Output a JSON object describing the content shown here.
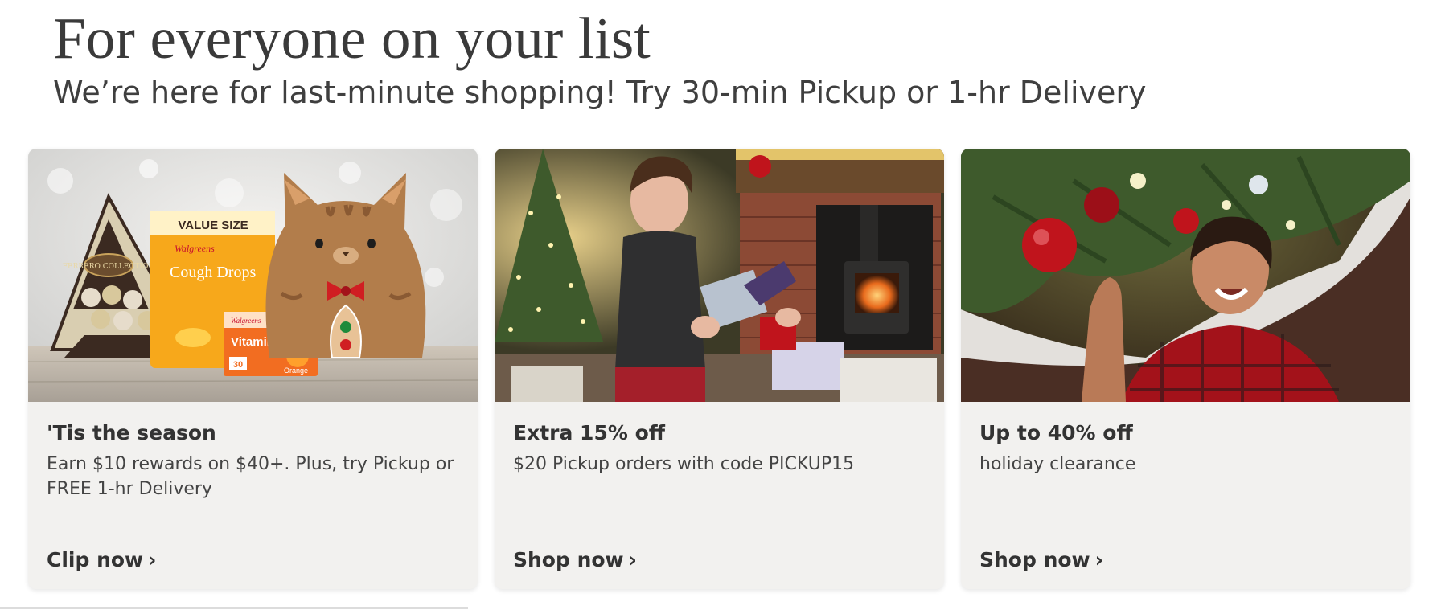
{
  "header": {
    "title": "For everyone on your list",
    "subtitle": "We’re here for last-minute shopping! Try 30-min Pickup or 1-hr Delivery"
  },
  "cards": [
    {
      "image_alt": "holiday-gifts-product-image",
      "heading": "'Tis the season",
      "body": "Earn $10 rewards on $40+. Plus, try Pickup or FREE 1-hr Delivery",
      "cta": "Clip now",
      "cta_icon": "chevron-right-icon",
      "product_labels": {
        "ferrero": "FERRERO COLLECTION",
        "value_size": "VALUE SIZE",
        "brand": "Walgreens",
        "cough": "Cough Drops",
        "vitamin": "Vitamin C",
        "count": "30",
        "flavor": "Orange"
      }
    },
    {
      "image_alt": "boy-opening-gift-photo",
      "heading": "Extra 15% off",
      "body": "$20 Pickup orders with code PICKUP15",
      "cta": "Shop now",
      "cta_icon": "chevron-right-icon"
    },
    {
      "image_alt": "child-under-christmas-tree-photo",
      "heading": "Up to 40% off",
      "body": "holiday clearance",
      "cta": "Shop now",
      "cta_icon": "chevron-right-icon"
    }
  ],
  "colors": {
    "card_background": "#f2f1ef",
    "text_primary": "#333333",
    "ornament_red": "#c0141c"
  }
}
